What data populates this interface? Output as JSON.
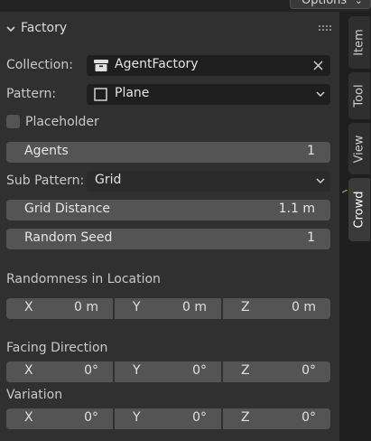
{
  "header": {
    "options_label": "Options"
  },
  "panel": {
    "title": "Factory",
    "collection": {
      "label": "Collection:",
      "value": "AgentFactory"
    },
    "pattern": {
      "label": "Pattern:",
      "value": "Plane"
    },
    "placeholder": {
      "label": "Placeholder",
      "checked": false
    },
    "agents": {
      "label": "Agents",
      "value": "1"
    },
    "sub_pattern": {
      "label": "Sub Pattern:",
      "value": "Grid"
    },
    "grid_distance": {
      "label": "Grid Distance",
      "value": "1.1 m"
    },
    "random_seed": {
      "label": "Random Seed",
      "value": "1"
    },
    "randomness_location": {
      "label": "Randomness in Location",
      "x_label": "X",
      "x": "0 m",
      "y_label": "Y",
      "y": "0 m",
      "z_label": "Z",
      "z": "0 m"
    },
    "facing_direction": {
      "label": "Facing Direction",
      "x_label": "X",
      "x": "0°",
      "y_label": "Y",
      "y": "0°",
      "z_label": "Z",
      "z": "0°"
    },
    "variation": {
      "label": "Variation",
      "x_label": "X",
      "x": "0°",
      "y_label": "Y",
      "y": "0°",
      "z_label": "Z",
      "z": "0°"
    }
  },
  "sidebar": {
    "tabs": [
      {
        "label": "Item"
      },
      {
        "label": "Tool"
      },
      {
        "label": "View"
      },
      {
        "label": "Crowd"
      }
    ],
    "active": "Crowd"
  },
  "colors": {
    "panel_bg": "#303030",
    "field_dark": "#1e1e1e",
    "field_light": "#545454",
    "accent": "#8a8a3a"
  }
}
